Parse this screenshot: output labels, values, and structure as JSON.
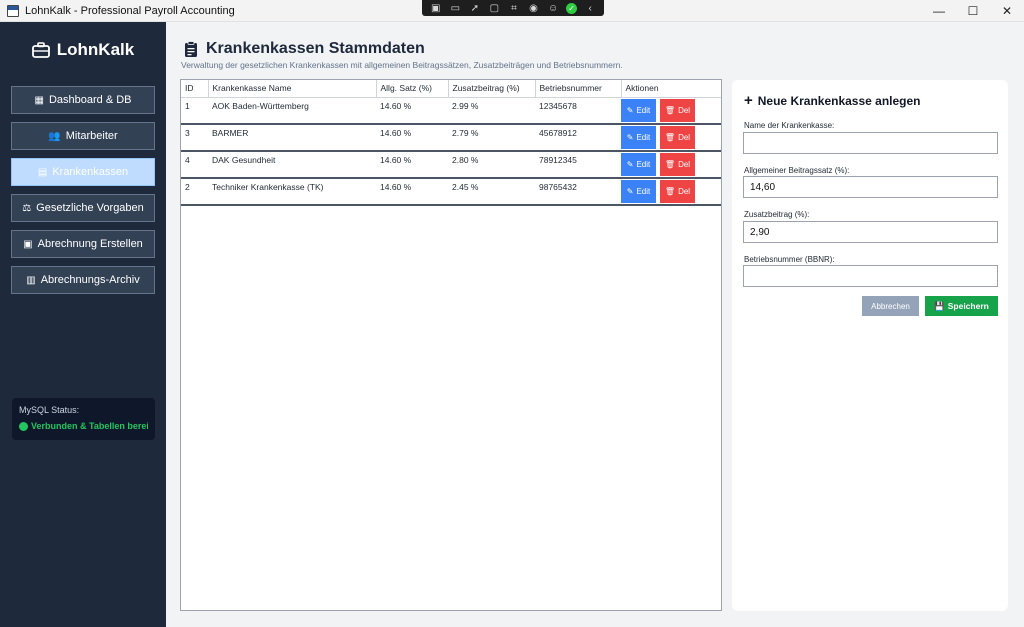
{
  "window": {
    "title": "LohnKalk - Professional Payroll Accounting",
    "controls": {
      "minimize": "—",
      "maximize": "☐",
      "close": "✕"
    }
  },
  "sidebar": {
    "brand": "LohnKalk",
    "items": [
      {
        "label": "Dashboard & DB",
        "icon": "chart-icon",
        "glyph": "▦"
      },
      {
        "label": "Mitarbeiter",
        "icon": "users-icon",
        "glyph": "👥"
      },
      {
        "label": "Krankenkassen",
        "icon": "document-icon",
        "glyph": "▤",
        "active": true
      },
      {
        "label": "Gesetzliche Vorgaben",
        "icon": "people-icon",
        "glyph": "⚖"
      },
      {
        "label": "Abrechnung Erstellen",
        "icon": "calculator-icon",
        "glyph": "▣"
      },
      {
        "label": "Abrechnungs-Archiv",
        "icon": "archive-icon",
        "glyph": "▥"
      }
    ],
    "mysql": {
      "label": "MySQL Status:",
      "status": "Verbunden & Tabellen bereit",
      "status_color": "#22c55e"
    }
  },
  "main": {
    "title": "Krankenkassen Stammdaten",
    "subtitle": "Verwaltung der gesetzlichen Krankenkassen mit allgemeinen Beitragssätzen, Zusatzbeiträgen und Betriebsnummern.",
    "table": {
      "columns": [
        "ID",
        "Krankenkasse Name",
        "Allg. Satz (%)",
        "Zusatzbeitrag (%)",
        "Betriebsnummer",
        "Aktionen"
      ],
      "edit_label": "Edit",
      "delete_label": "Del",
      "rows": [
        {
          "id": "1",
          "name": "AOK Baden-Württemberg",
          "rate": "14.60 %",
          "extra": "2.99 %",
          "number": "12345678"
        },
        {
          "id": "3",
          "name": "BARMER",
          "rate": "14.60 %",
          "extra": "2.79 %",
          "number": "45678912"
        },
        {
          "id": "4",
          "name": "DAK Gesundheit",
          "rate": "14.60 %",
          "extra": "2.80 %",
          "number": "78912345"
        },
        {
          "id": "2",
          "name": "Techniker Krankenkasse (TK)",
          "rate": "14.60 %",
          "extra": "2.45 %",
          "number": "98765432"
        }
      ]
    }
  },
  "form": {
    "title": "Neue Krankenkasse anlegen",
    "fields": [
      {
        "label": "Name der Krankenkasse:",
        "value": ""
      },
      {
        "label": "Allgemeiner Beitragssatz (%):",
        "value": "14,60"
      },
      {
        "label": "Zusatzbeitrag (%):",
        "value": "2,90"
      },
      {
        "label": "Betriebsnummer (BBNR):",
        "value": ""
      }
    ],
    "cancel_label": "Abbrechen",
    "save_label": "Speichern"
  },
  "colors": {
    "sidebar_bg": "#1e293b",
    "accent_edit": "#3b82f6",
    "accent_delete": "#ef4444",
    "accent_save": "#16a34a"
  }
}
